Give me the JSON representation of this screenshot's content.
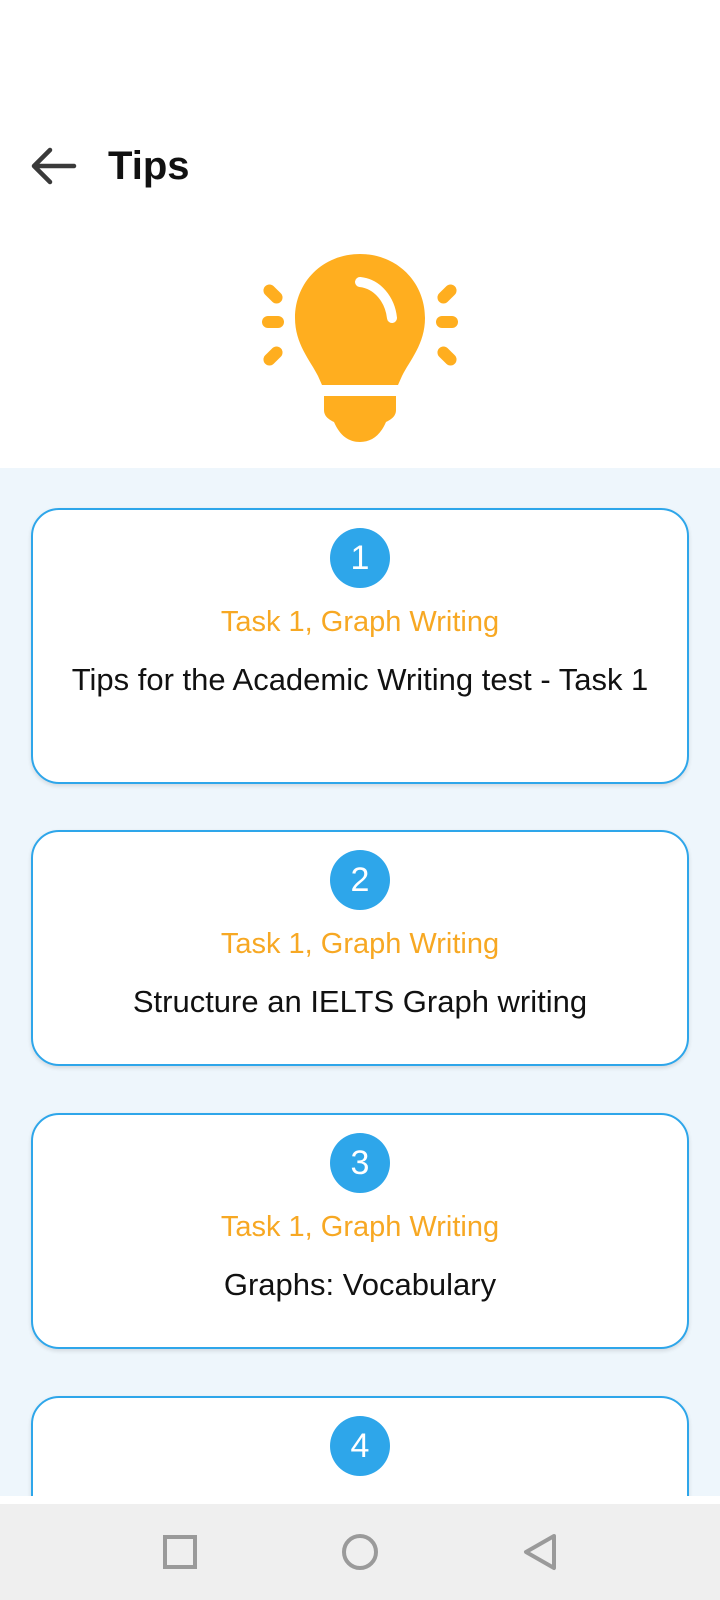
{
  "header": {
    "title": "Tips",
    "back_icon": "arrow-left-icon"
  },
  "hero": {
    "icon": "lightbulb-icon",
    "icon_color": "#FFAE1F"
  },
  "colors": {
    "accent": "#2EA6EA",
    "category": "#F7A823",
    "list_background": "#EEF6FC"
  },
  "tips": [
    {
      "number": "1",
      "category": "Task 1, Graph Writing",
      "title": "Tips for the Academic Writing test - Task 1"
    },
    {
      "number": "2",
      "category": "Task 1, Graph Writing",
      "title": "Structure an IELTS Graph writing"
    },
    {
      "number": "3",
      "category": "Task 1, Graph Writing",
      "title": "Graphs: Vocabulary"
    },
    {
      "number": "4",
      "category": "",
      "title": ""
    }
  ],
  "navigation": {
    "recents_icon": "square-icon",
    "home_icon": "circle-icon",
    "back_icon": "triangle-back-icon"
  }
}
